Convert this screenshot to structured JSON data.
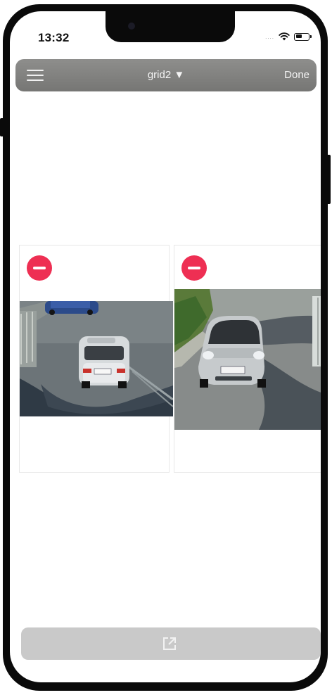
{
  "status_bar": {
    "time": "13:32",
    "signal": "....",
    "wifi_icon": "wifi-icon",
    "battery_icon": "battery-icon"
  },
  "toolbar": {
    "menu_icon": "hamburger-icon",
    "title": "grid2 ▼",
    "done_label": "Done"
  },
  "grid": {
    "cells": [
      {
        "remove_icon": "minus-circle-icon",
        "feed": "camera-feed-silver-sedan"
      },
      {
        "remove_icon": "minus-circle-icon",
        "feed": "camera-feed-silver-hatchback"
      }
    ]
  },
  "bottom_bar": {
    "share_icon": "share-external-icon"
  },
  "colors": {
    "toolbar": "#7f7f7d",
    "remove": "#ee2f53",
    "bottom_bar": "#c9c9c9"
  }
}
